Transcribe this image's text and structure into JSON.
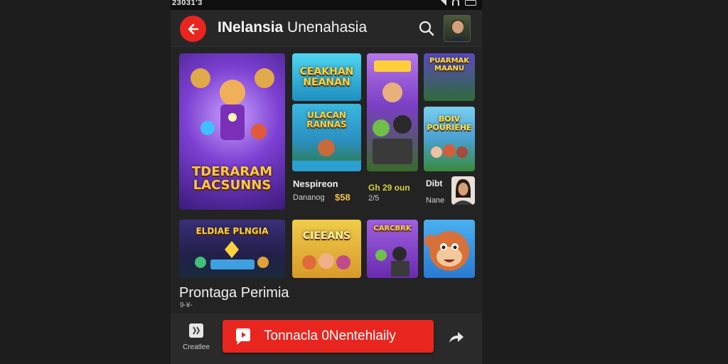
{
  "status_bar": {
    "time": "23031'3"
  },
  "app_bar": {
    "title_bold": "INelansia",
    "title_rest": " Unenahasia",
    "search_icon": "search-icon",
    "back_icon": "arrow-left-icon"
  },
  "tiles": [
    {
      "title": "TDERARAM\nLACSUNNS",
      "color": "#7b3fd1"
    },
    {
      "title": "CEAKHAN\nNEANAN",
      "color": "#25b5d9"
    },
    {
      "title": "",
      "color": "#9a5cd6"
    },
    {
      "title": "PUARMAK\nMAANU",
      "color": "#4a3a9a"
    },
    {
      "title": "ULACAN\nRANNAS",
      "color": "#2a9fc7"
    },
    {
      "title": "",
      "color": "#4aa0d0"
    },
    {
      "title": "BOIV\nPOURIEHE",
      "color": "#6ac3e8"
    },
    {
      "title": "ELDIAE PLNGIA",
      "color": "#2e2a6a"
    },
    {
      "title": "CIEEANS",
      "color": "#e0b43a"
    },
    {
      "title": "CARCBRK",
      "color": "#8a3fc9"
    },
    {
      "title": "",
      "color": "#3a8fd8"
    }
  ],
  "meta": {
    "col2_title": "Nespireon",
    "col2_sub": "Dananog",
    "col2_price": "$58",
    "col3_title": "Gh 29 oun",
    "col3_sub": "2/5",
    "col4_title": "Dibt",
    "col4_sub": "Nane"
  },
  "section": {
    "title": "Prontaga Perimia",
    "sub": "9-¥-"
  },
  "bottom_bar": {
    "left_label": "Creatlee",
    "cta_label": "Tonnacla 0Nentehlaily",
    "share_icon": "share-icon"
  }
}
